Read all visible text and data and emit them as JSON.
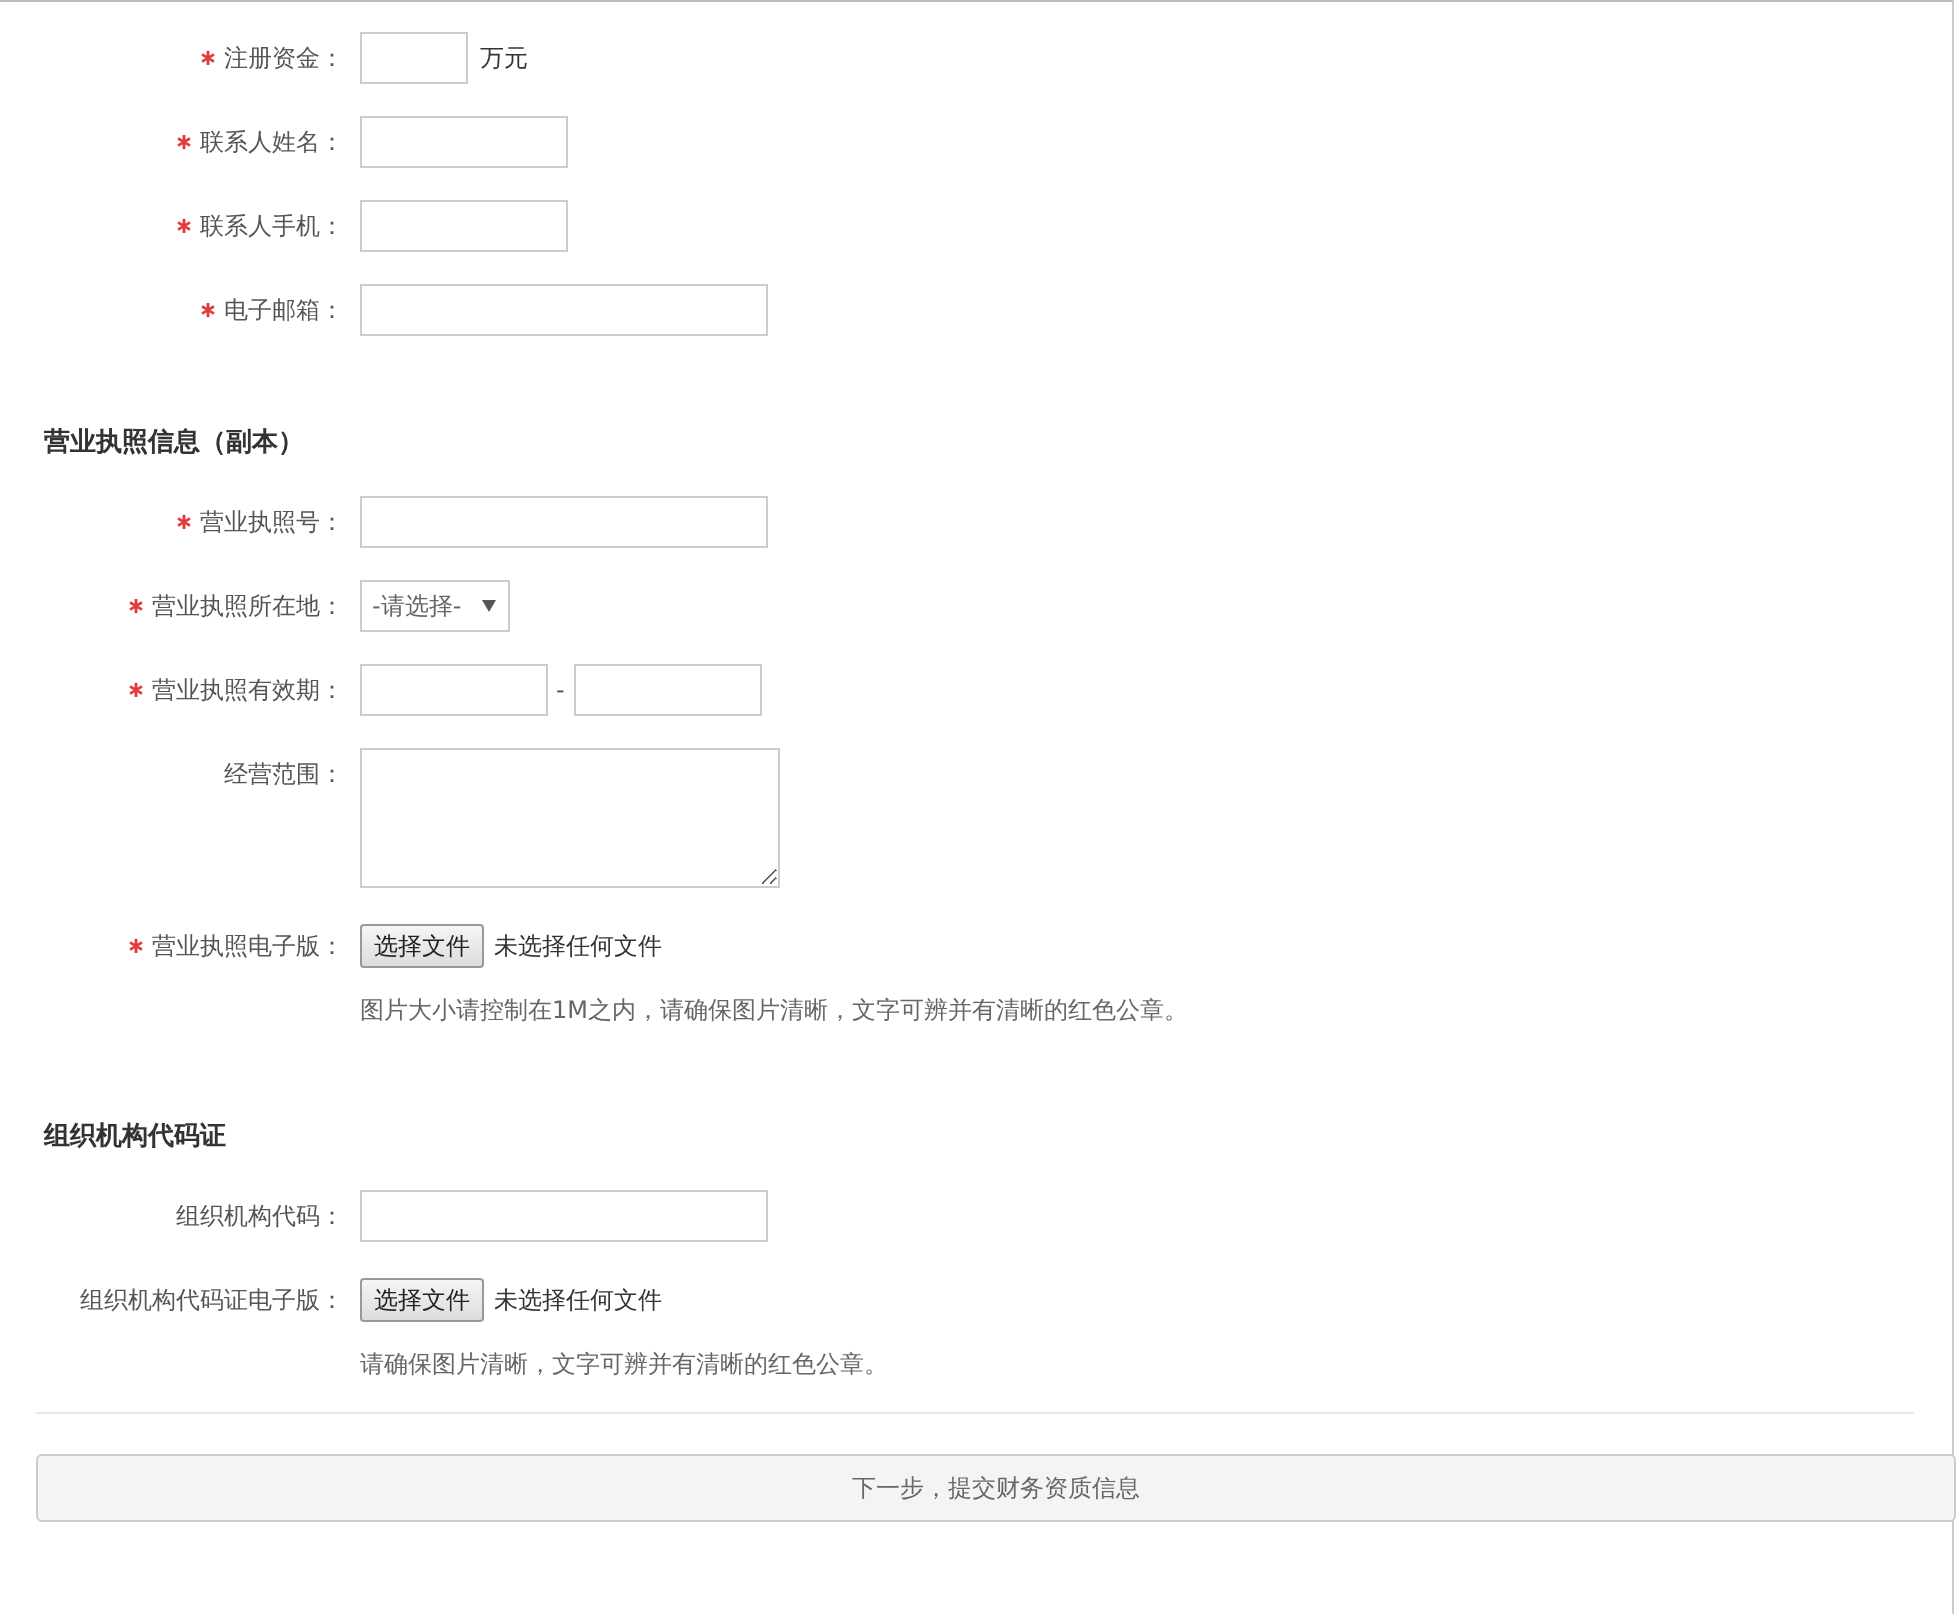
{
  "sections": [
    {
      "rows": [
        {
          "kind": "amount",
          "label": "注册资金：",
          "required": true,
          "unit": "万元"
        },
        {
          "kind": "short-text",
          "label": "联系人姓名：",
          "required": true
        },
        {
          "kind": "short-text",
          "label": "联系人手机：",
          "required": true
        },
        {
          "kind": "text",
          "label": "电子邮箱：",
          "required": true
        }
      ]
    },
    {
      "title": "营业执照信息（副本）",
      "rows": [
        {
          "kind": "text",
          "label": "营业执照号：",
          "required": true
        },
        {
          "kind": "select",
          "label": "营业执照所在地：",
          "required": true,
          "value": "-请选择-"
        },
        {
          "kind": "date-range",
          "label": "营业执照有效期：",
          "required": true,
          "separator": "-"
        },
        {
          "kind": "textarea",
          "label": "经营范围：",
          "required": false
        },
        {
          "kind": "file",
          "label": "营业执照电子版：",
          "required": true,
          "button": "选择文件",
          "status": "未选择任何文件",
          "hint": "图片大小请控制在1M之内，请确保图片清晰，文字可辨并有清晰的红色公章。"
        }
      ]
    },
    {
      "title": "组织机构代码证",
      "rows": [
        {
          "kind": "text",
          "label": "组织机构代码：",
          "required": false
        },
        {
          "kind": "file",
          "label": "组织机构代码证电子版：",
          "required": false,
          "button": "选择文件",
          "status": "未选择任何文件",
          "hint": "请确保图片清晰，文字可辨并有清晰的红色公章。"
        }
      ]
    }
  ],
  "next_button": "下一步，提交财务资质信息"
}
